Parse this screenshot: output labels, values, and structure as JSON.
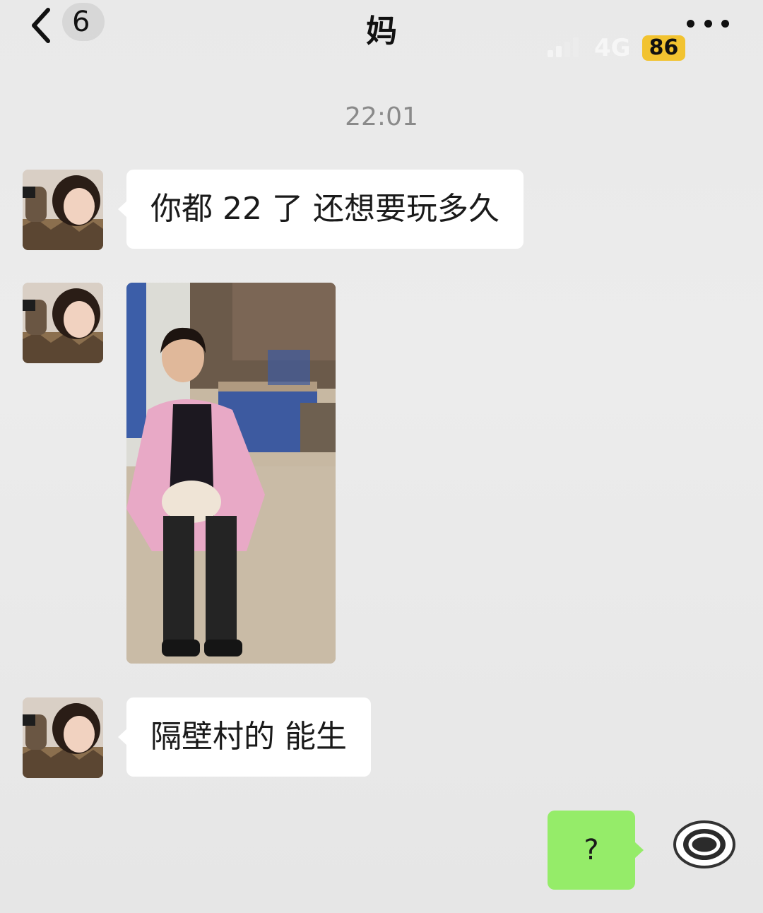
{
  "header": {
    "title": "妈",
    "unread_count": "6",
    "back_label": "返回"
  },
  "status_bar": {
    "network": "4G",
    "battery": "86"
  },
  "chat": {
    "timestamp": "22:01",
    "messages": [
      {
        "from": "contact",
        "type": "text",
        "text": "你都 22 了 还想要玩多久"
      },
      {
        "from": "contact",
        "type": "image"
      },
      {
        "from": "contact",
        "type": "text",
        "text": "隔壁村的 能生"
      },
      {
        "from": "me",
        "type": "text",
        "text": "?"
      }
    ]
  },
  "colors": {
    "background": "#ededed",
    "incoming_bubble": "#ffffff",
    "outgoing_bubble": "#95ec69",
    "battery_badge": "#f2c330"
  },
  "icons": {
    "back": "chevron-left-icon",
    "more": "more-dots-icon"
  }
}
